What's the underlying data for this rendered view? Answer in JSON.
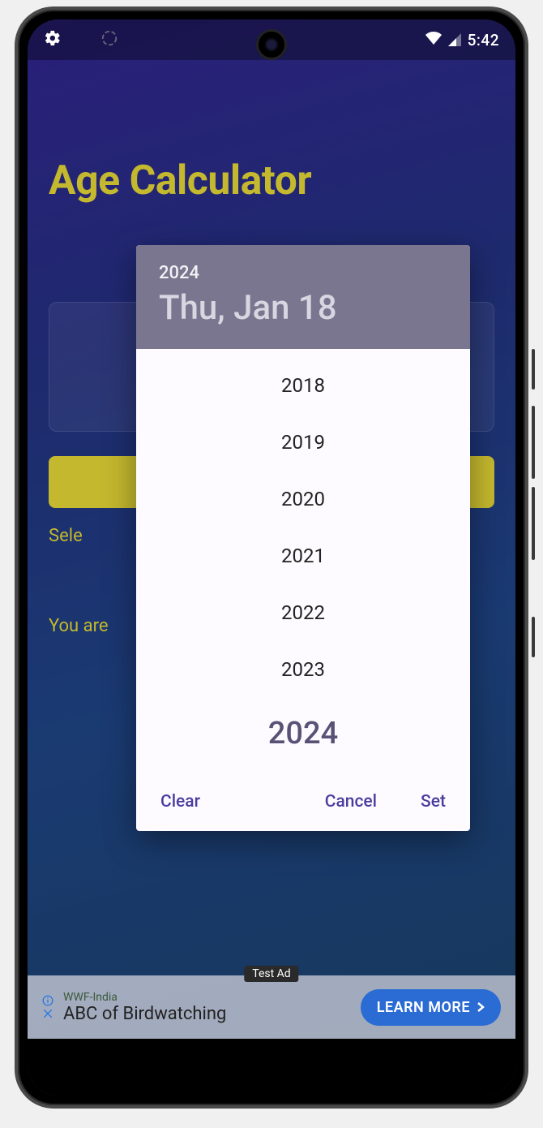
{
  "status_bar": {
    "time": "5:42"
  },
  "app": {
    "title": "Age Calculator",
    "selected_label_prefix": "Sele",
    "result_prefix": "You are"
  },
  "ad": {
    "badge": "Test Ad",
    "small_text": "WWF-India",
    "title": "ABC of Birdwatching",
    "cta": "LEARN MORE"
  },
  "date_picker": {
    "header_year": "2024",
    "header_date": "Thu, Jan 18",
    "years": [
      "2018",
      "2019",
      "2020",
      "2021",
      "2022",
      "2023",
      "2024"
    ],
    "selected_year": "2024",
    "actions": {
      "clear": "Clear",
      "cancel": "Cancel",
      "set": "Set"
    }
  }
}
